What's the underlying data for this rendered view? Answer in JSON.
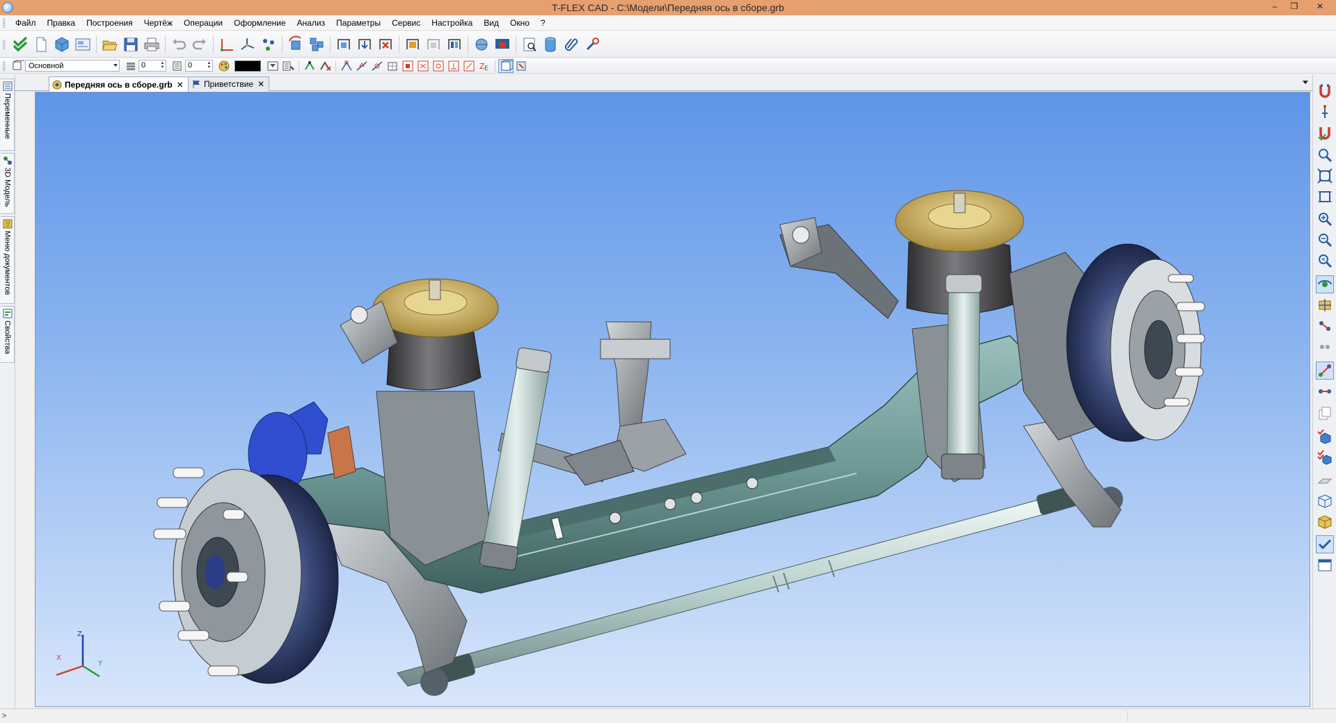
{
  "window": {
    "title": "T-FLEX CAD - C:\\Модели\\Передняя ось в сборе.grb",
    "minimize": "–",
    "restore": "❐",
    "close": "✕"
  },
  "menu": {
    "items": [
      "Файл",
      "Правка",
      "Построения",
      "Чертёж",
      "Операции",
      "Оформление",
      "Анализ",
      "Параметры",
      "Сервис",
      "Настройка",
      "Вид",
      "Окно",
      "?"
    ]
  },
  "toolbar_props": {
    "layer_value": "Основной",
    "level_value": "0",
    "priority_value": "0",
    "color_value": "#000000"
  },
  "left_panel": {
    "tabs": [
      "Переменные",
      "3D Модель",
      "Меню документов",
      "Свойства"
    ]
  },
  "document_tabs": [
    {
      "label": "Передняя ось в сборе.grb",
      "active": true,
      "close": "✕"
    },
    {
      "label": "Приветствие",
      "active": false,
      "close": "✕"
    }
  ],
  "axis_triad": {
    "x": "X",
    "y": "Y",
    "z": "Z"
  },
  "statusbar": {
    "caret": ">"
  },
  "colors": {
    "title_bar": "#e69f6e",
    "viewport_top": "#5f95e8",
    "viewport_bottom": "#d8e6fb",
    "axle_beam": "#6f9a98",
    "air_spring": "#4a4a4c",
    "spring_cap": "#c9b06a",
    "brake_disc": "#3a4a7a",
    "tie_rod": "#c8dbd8"
  }
}
